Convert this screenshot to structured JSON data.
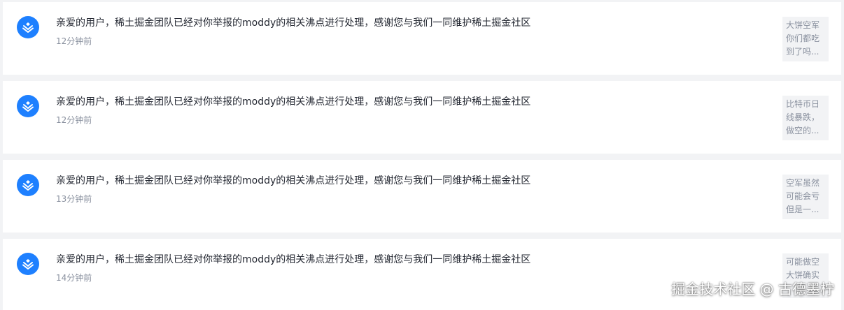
{
  "notifications": [
    {
      "icon": "juejin-logo-icon",
      "message": "亲爱的用户，稀土掘金团队已经对你举报的moddy的相关沸点进行处理，感谢您与我们一同维护稀土掘金社区",
      "time": "12分钟前",
      "preview_lines": [
        "大饼空军",
        "你们都吃",
        "到了吗..."
      ]
    },
    {
      "icon": "juejin-logo-icon",
      "message": "亲爱的用户，稀土掘金团队已经对你举报的moddy的相关沸点进行处理，感谢您与我们一同维护稀土掘金社区",
      "time": "12分钟前",
      "preview_lines": [
        "比特币日",
        "线暴跌，",
        "做空的..."
      ]
    },
    {
      "icon": "juejin-logo-icon",
      "message": "亲爱的用户，稀土掘金团队已经对你举报的moddy的相关沸点进行处理，感谢您与我们一同维护稀土掘金社区",
      "time": "13分钟前",
      "preview_lines": [
        "空军虽然",
        "可能会亏",
        "但是一..."
      ]
    },
    {
      "icon": "juejin-logo-icon",
      "message": "亲爱的用户，稀土掘金团队已经对你举报的moddy的相关沸点进行处理，感谢您与我们一同维护稀土掘金社区",
      "time": "14分钟前",
      "preview_lines": [
        "可能做空",
        "大饼确实",
        ""
      ]
    }
  ],
  "watermark": "掘金技术社区 @ 古德墨柠",
  "colors": {
    "brand": "#1e80ff",
    "text": "#252933",
    "muted": "#8a919f",
    "background": "#f2f3f5"
  }
}
